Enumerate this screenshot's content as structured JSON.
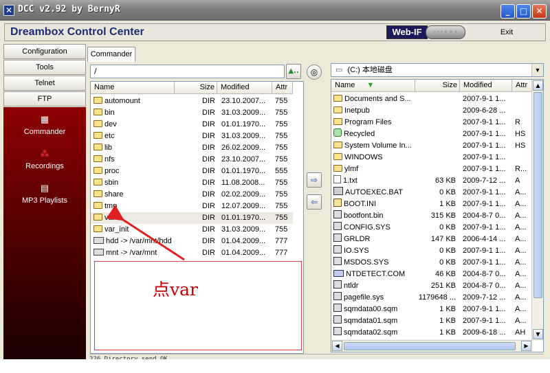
{
  "window": {
    "title": "DCC v2.92 by BernyR",
    "app_icon_glyph": "✕",
    "controls": {
      "minimize": "_",
      "maximize": "□",
      "close": "✕"
    }
  },
  "header": {
    "app_title": "Dreambox Control Center",
    "webif_label": "Web-IF",
    "remote_label": "· · · ◦ ◦ ◦",
    "exit_label": "Exit"
  },
  "nav": {
    "buttons": [
      "Configuration",
      "Tools",
      "Telnet",
      "FTP"
    ],
    "side_items": [
      {
        "label": "Commander",
        "icon": "grid-icon",
        "glyph": "▦"
      },
      {
        "label": "Recordings",
        "icon": "recordings-icon",
        "glyph": "⁂"
      },
      {
        "label": "MP3 Playlists",
        "icon": "playlist-icon",
        "glyph": "▤"
      }
    ]
  },
  "tabs": {
    "commander": "Commander"
  },
  "left_panel": {
    "path": "/",
    "up_button_glyph": "▲..",
    "refresh_glyph": "◎",
    "columns": {
      "name": "Name",
      "size": "Size",
      "modified": "Modified",
      "attr": "Attr"
    },
    "rows": [
      {
        "name": "automount",
        "size": "DIR",
        "modified": "23.10.2007...",
        "attr": "755",
        "type": "folder"
      },
      {
        "name": "bin",
        "size": "DIR",
        "modified": "31.03.2009...",
        "attr": "755",
        "type": "folder"
      },
      {
        "name": "dev",
        "size": "DIR",
        "modified": "01.01.1970...",
        "attr": "755",
        "type": "folder"
      },
      {
        "name": "etc",
        "size": "DIR",
        "modified": "31.03.2009...",
        "attr": "755",
        "type": "folder"
      },
      {
        "name": "lib",
        "size": "DIR",
        "modified": "26.02.2009...",
        "attr": "755",
        "type": "folder"
      },
      {
        "name": "nfs",
        "size": "DIR",
        "modified": "23.10.2007...",
        "attr": "755",
        "type": "folder"
      },
      {
        "name": "proc",
        "size": "DIR",
        "modified": "01.01.1970...",
        "attr": "555",
        "type": "folder"
      },
      {
        "name": "sbin",
        "size": "DIR",
        "modified": "11.08.2008...",
        "attr": "755",
        "type": "folder"
      },
      {
        "name": "share",
        "size": "DIR",
        "modified": "02.02.2009...",
        "attr": "755",
        "type": "folder"
      },
      {
        "name": "tmp",
        "size": "DIR",
        "modified": "12.07.2009...",
        "attr": "755",
        "type": "folder"
      },
      {
        "name": "var",
        "size": "DIR",
        "modified": "01.01.1970...",
        "attr": "755",
        "type": "folder",
        "selected": true
      },
      {
        "name": "var_init",
        "size": "DIR",
        "modified": "31.03.2009...",
        "attr": "755",
        "type": "folder"
      },
      {
        "name": "hdd -> /var/mnt/hdd",
        "size": "DIR",
        "modified": "01.04.2009...",
        "attr": "777",
        "type": "link"
      },
      {
        "name": "mnt -> /var/mnt",
        "size": "DIR",
        "modified": "01.04.2009...",
        "attr": "777",
        "type": "link"
      }
    ]
  },
  "transfer": {
    "copy_right_glyph": "⇨",
    "copy_left_glyph": "⇦"
  },
  "right_panel": {
    "drive": "(C:) 本地磁盘",
    "drive_glyph": "▭",
    "sort_glyph": "▼",
    "columns": {
      "name": "Name",
      "size": "Size",
      "modified": "Modified",
      "attr": "Attr"
    },
    "rows": [
      {
        "name": "Documents and S...",
        "size": "",
        "modified": "2007-9-1 1...",
        "attr": "",
        "type": "folder"
      },
      {
        "name": "Inetpub",
        "size": "",
        "modified": "2009-6-28 ...",
        "attr": "",
        "type": "folder"
      },
      {
        "name": "Program Files",
        "size": "",
        "modified": "2007-9-1 1...",
        "attr": "R",
        "type": "folder"
      },
      {
        "name": "Recycled",
        "size": "",
        "modified": "2007-9-1 1...",
        "attr": "HS",
        "type": "recycle"
      },
      {
        "name": "System Volume In...",
        "size": "",
        "modified": "2007-9-1 1...",
        "attr": "HS",
        "type": "folder"
      },
      {
        "name": "WINDOWS",
        "size": "",
        "modified": "2007-9-1 1...",
        "attr": "",
        "type": "folder"
      },
      {
        "name": "ylmf",
        "size": "",
        "modified": "2007-9-1 1...",
        "attr": "R...",
        "type": "folder"
      },
      {
        "name": "1.txt",
        "size": "63 KB",
        "modified": "2009-7-12 ...",
        "attr": "A",
        "type": "file"
      },
      {
        "name": "AUTOEXEC.BAT",
        "size": "0 KB",
        "modified": "2007-9-1 1...",
        "attr": "A...",
        "type": "bat"
      },
      {
        "name": "BOOT.INI",
        "size": "1 KB",
        "modified": "2007-9-1 1...",
        "attr": "A...",
        "type": "ini"
      },
      {
        "name": "bootfont.bin",
        "size": "315 KB",
        "modified": "2004-8-7 0...",
        "attr": "A...",
        "type": "sys"
      },
      {
        "name": "CONFIG.SYS",
        "size": "0 KB",
        "modified": "2007-9-1 1...",
        "attr": "A...",
        "type": "sys"
      },
      {
        "name": "GRLDR",
        "size": "147 KB",
        "modified": "2006-4-14 ...",
        "attr": "A...",
        "type": "sys"
      },
      {
        "name": "IO.SYS",
        "size": "0 KB",
        "modified": "2007-9-1 1...",
        "attr": "A...",
        "type": "sys"
      },
      {
        "name": "MSDOS.SYS",
        "size": "0 KB",
        "modified": "2007-9-1 1...",
        "attr": "A...",
        "type": "sys"
      },
      {
        "name": "NTDETECT.COM",
        "size": "46 KB",
        "modified": "2004-8-7 0...",
        "attr": "A...",
        "type": "com"
      },
      {
        "name": "ntldr",
        "size": "251 KB",
        "modified": "2004-8-7 0...",
        "attr": "A...",
        "type": "sys"
      },
      {
        "name": "pagefile.sys",
        "size": "1179648 ...",
        "modified": "2009-7-12 ...",
        "attr": "A...",
        "type": "sys"
      },
      {
        "name": "sqmdata00.sqm",
        "size": "1 KB",
        "modified": "2007-9-1 1...",
        "attr": "A...",
        "type": "sys"
      },
      {
        "name": "sqmdata01.sqm",
        "size": "1 KB",
        "modified": "2007-9-1 1...",
        "attr": "A...",
        "type": "sys"
      },
      {
        "name": "sqmdata02.sqm",
        "size": "1 KB",
        "modified": "2009-6-18 ...",
        "attr": "AH",
        "type": "sys"
      }
    ]
  },
  "annotation": {
    "text": "点var",
    "color": "#cc0000"
  },
  "status_line": "226 Directory send OK.",
  "colors": {
    "accent": "#1c2c78",
    "sidebar": "#8e0000",
    "selected_row": "#edeae4",
    "annotation": "#e04040"
  }
}
